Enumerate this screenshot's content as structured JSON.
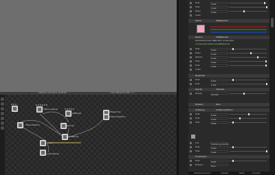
{
  "status_bar": {
    "left": "2200 pts, 0.00 Tunes, 00:00:60",
    "right": "0 Tris, Diffuse 0.0 768..., 4 ..."
  },
  "graph": {
    "nodes": [
      {
        "label": "RGBspectrum"
      },
      {
        "label": "Diffuse material"
      },
      {
        "label": "ORBmetal"
      },
      {
        "label": "Specular"
      },
      {
        "label": "Scattering Medium"
      },
      {
        "label": "Diffuse Material"
      },
      {
        "label": "Light Material"
      },
      {
        "label": "Texture"
      }
    ],
    "tools": [
      "select",
      "pan",
      "zoom",
      "add",
      "delete",
      "group",
      "layout"
    ]
  },
  "properties": {
    "sections": [
      {
        "label": "Emission",
        "value": "None"
      },
      {
        "label": "Roughness",
        "value": ""
      },
      {
        "label": "Albedo",
        "value": "RGBspectrum"
      },
      {
        "label": "Medium",
        "value": "ORBMetal.dat"
      },
      {
        "label": "Opacity",
        "value": "Unbiased"
      },
      {
        "label": "Scattering",
        "value": "Scattering Medium"
      },
      {
        "label": "Transmission",
        "value": ""
      }
    ],
    "rows": [
      {
        "label": "Float",
        "value": "0.000"
      },
      {
        "label": "Float",
        "value": "1.000"
      },
      {
        "label": "Power",
        "value": "1.000"
      },
      {
        "label": "Gamma",
        "value": "2.200"
      },
      {
        "label": "Invert",
        "value": ""
      },
      {
        "label": "Float",
        "value": "0.001"
      },
      {
        "label": "Float",
        "value": "1.000"
      },
      {
        "label": "Density",
        "value": "100.000"
      },
      {
        "label": "Float",
        "value": "0.500"
      },
      {
        "label": "Float",
        "value": "0.250"
      },
      {
        "label": "Link",
        "value": "Scattering_direction"
      },
      {
        "label": "Float",
        "value": "0.000"
      },
      {
        "label": "Float",
        "value": "1.000"
      },
      {
        "label": "Emission",
        "value": "None"
      }
    ],
    "file_info": "1024x1024 pixels, RGBA 8bit, 14 Sep 2012",
    "file_path": "C:/Users/Demo/Textures/ORBMetal.dat",
    "swatch_color": "#f4a6bf"
  },
  "bottom_bar": {
    "left": "OctaneLive account",
    "status_label": "activated",
    "mid": "Status",
    "right": "connected"
  }
}
